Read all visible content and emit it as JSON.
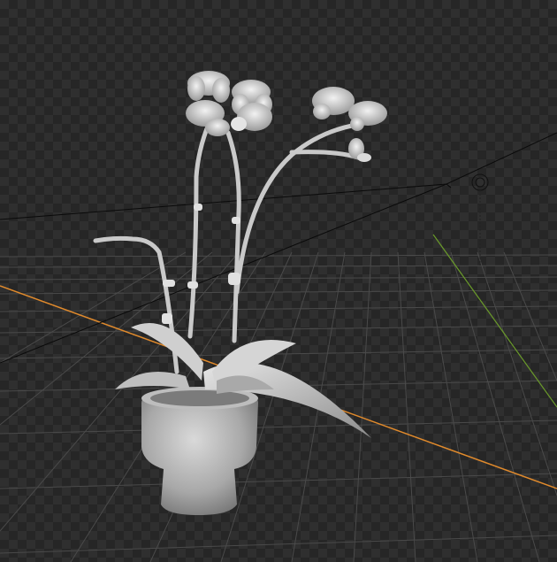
{
  "viewport": {
    "background_dark": "#262626",
    "background_light": "#2f2f2f",
    "grid_color": "#4a4a4a",
    "x_axis_color": "#e08a2c",
    "y_axis_color": "#6a9a2a",
    "model_color": "#d8d8d8"
  },
  "objects": [
    {
      "name": "orchid-plant-model",
      "type": "mesh"
    },
    {
      "name": "camera-object",
      "type": "camera"
    },
    {
      "name": "light-object",
      "type": "light"
    }
  ]
}
